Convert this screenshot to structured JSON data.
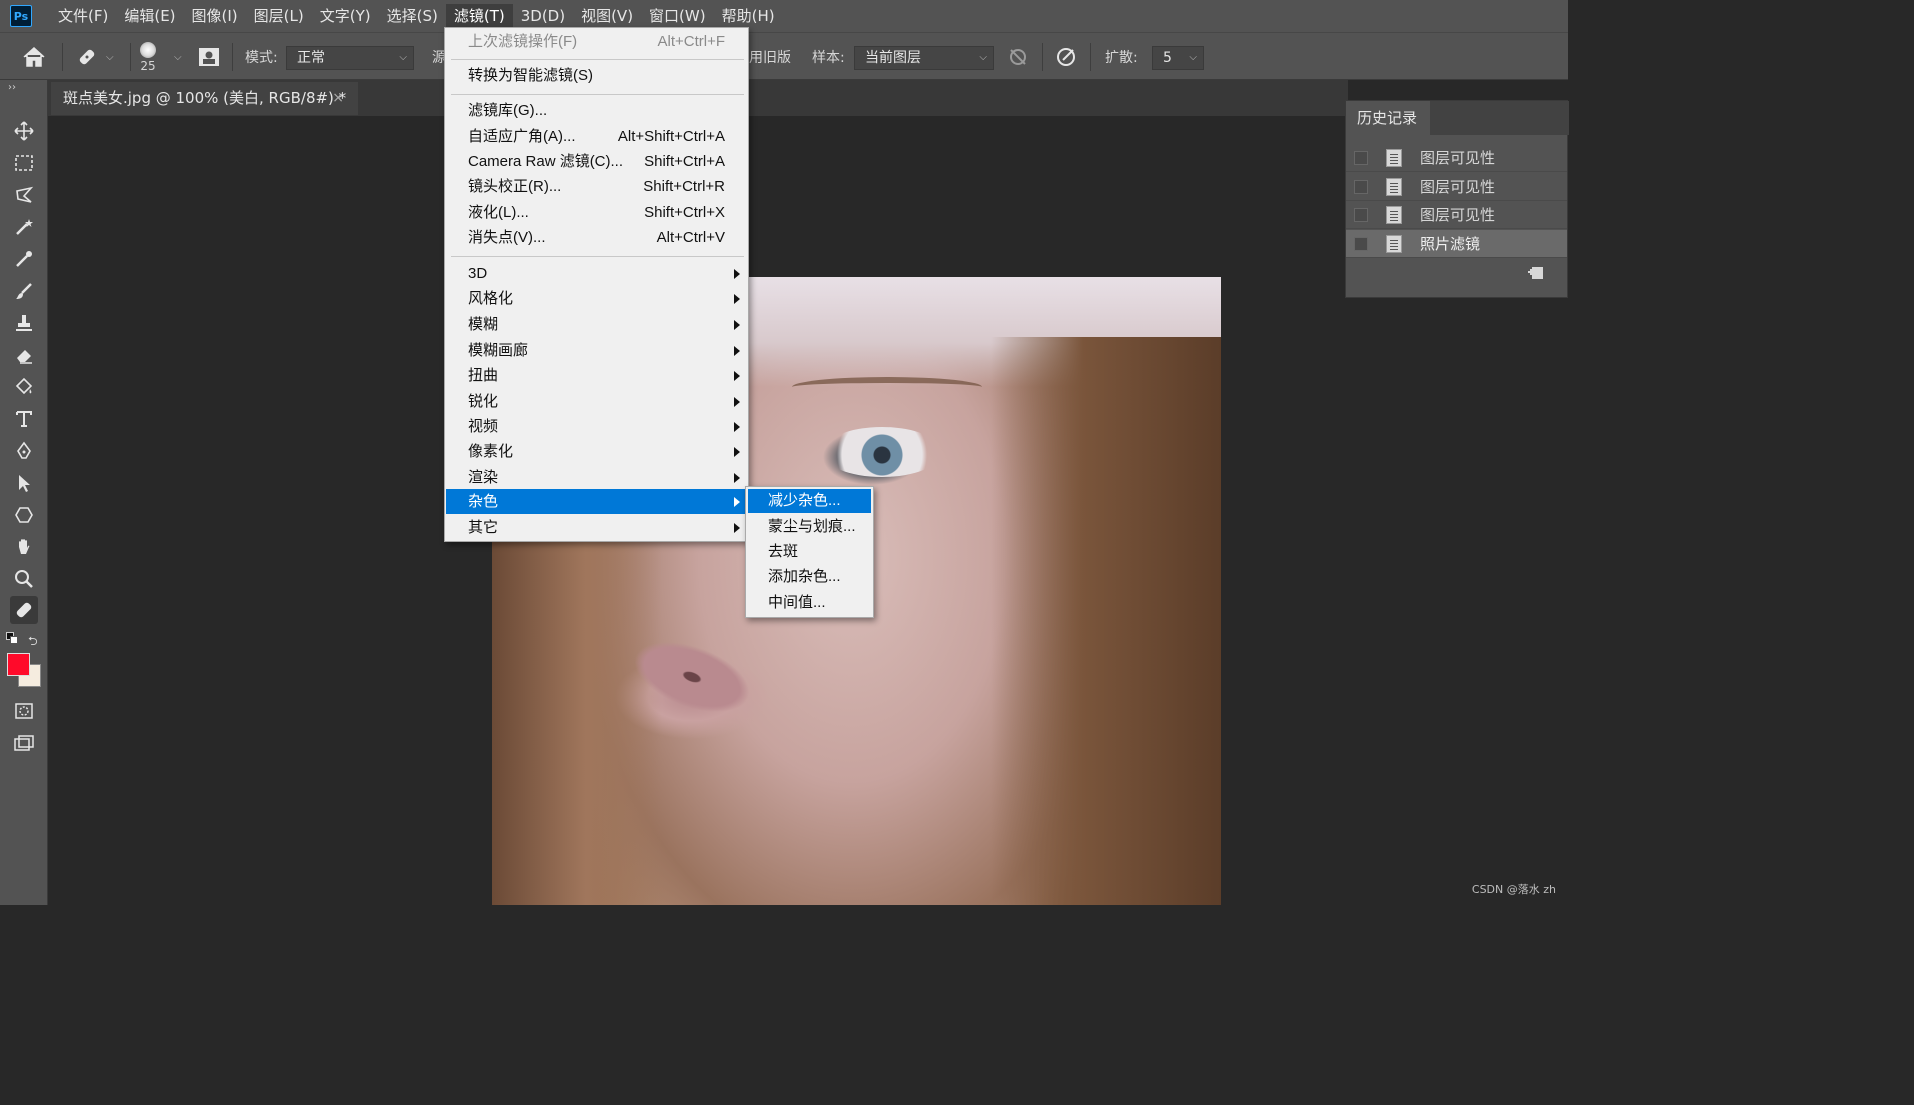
{
  "app": {
    "logo": "Ps"
  },
  "menubar": {
    "items": [
      "文件(F)",
      "编辑(E)",
      "图像(I)",
      "图层(L)",
      "文字(Y)",
      "选择(S)",
      "滤镜(T)",
      "3D(D)",
      "视图(V)",
      "窗口(W)",
      "帮助(H)"
    ],
    "active": "滤镜(T)"
  },
  "options": {
    "brush_size": "25",
    "mode_label": "模式:",
    "mode_value": "正常",
    "source_label_partial": "源",
    "old_version_partial": "用旧版",
    "sample_label": "样本:",
    "sample_value": "当前图层",
    "diffusion_label": "扩散:",
    "diffusion_value": "5"
  },
  "document": {
    "tab_title": "斑点美女.jpg @ 100% (美白, RGB/8#) *",
    "close": "×"
  },
  "filter_menu": {
    "last_filter": {
      "label": "上次滤镜操作(F)",
      "shortcut": "Alt+Ctrl+F"
    },
    "convert_smart": "转换为智能滤镜(S)",
    "group1": [
      {
        "label": "滤镜库(G)...",
        "shortcut": ""
      },
      {
        "label": "自适应广角(A)...",
        "shortcut": "Alt+Shift+Ctrl+A"
      },
      {
        "label": "Camera Raw 滤镜(C)...",
        "shortcut": "Shift+Ctrl+A"
      },
      {
        "label": "镜头校正(R)...",
        "shortcut": "Shift+Ctrl+R"
      },
      {
        "label": "液化(L)...",
        "shortcut": "Shift+Ctrl+X"
      },
      {
        "label": "消失点(V)...",
        "shortcut": "Alt+Ctrl+V"
      }
    ],
    "submenus": [
      "3D",
      "风格化",
      "模糊",
      "模糊画廊",
      "扭曲",
      "锐化",
      "视频",
      "像素化",
      "渲染",
      "杂色",
      "其它"
    ],
    "highlighted": "杂色"
  },
  "noise_submenu": {
    "items": [
      "减少杂色...",
      "蒙尘与划痕...",
      "去斑",
      "添加杂色...",
      "中间值..."
    ],
    "highlighted": "减少杂色..."
  },
  "history": {
    "title": "历史记录",
    "items": [
      "图层可见性",
      "图层可见性",
      "图层可见性",
      "照片滤镜"
    ],
    "current": "照片滤镜"
  },
  "colors": {
    "foreground": "#ff0a2a",
    "background": "#f5ecdf",
    "menu_highlight": "#0078d7"
  },
  "watermark": "CSDN @落水 zh"
}
